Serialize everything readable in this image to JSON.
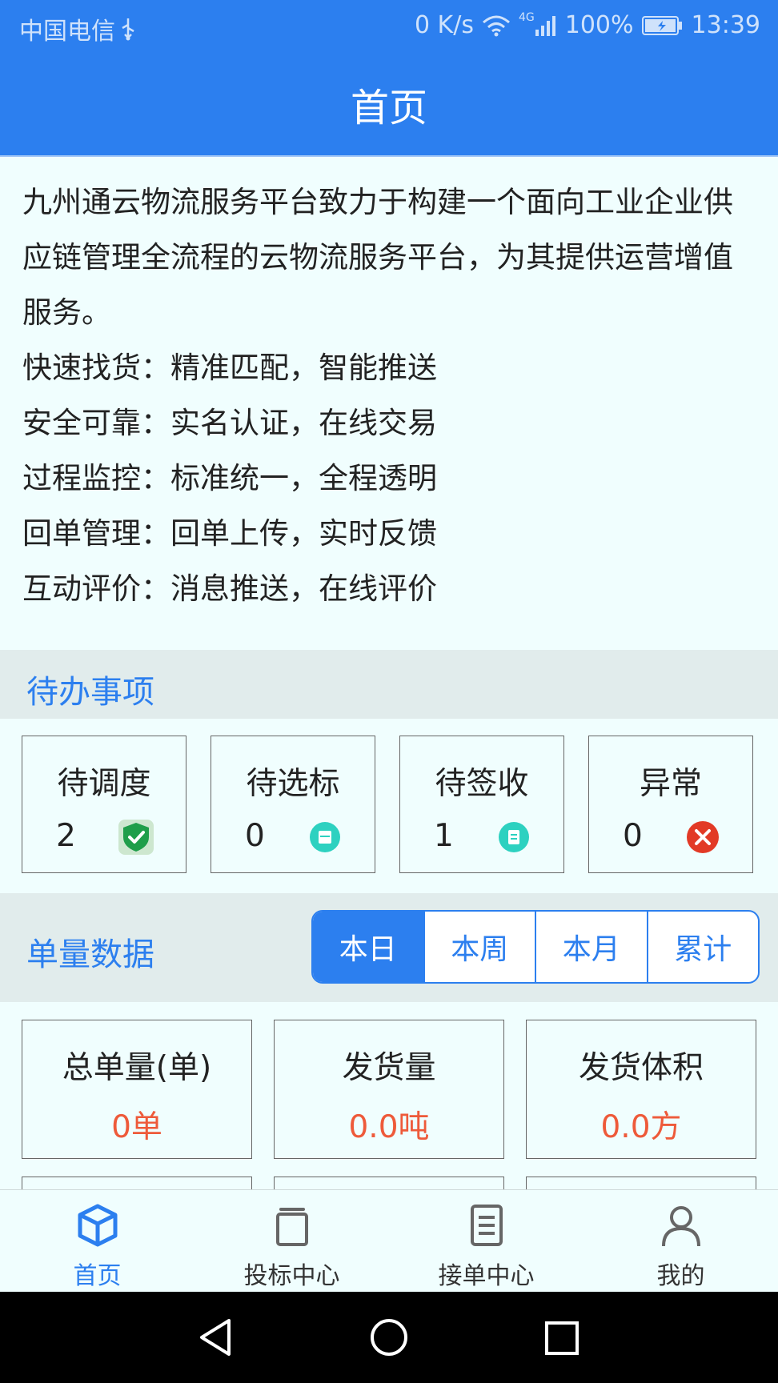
{
  "status_bar": {
    "carrier": "中国电信",
    "net_speed": "0 K/s",
    "network_type": "4G",
    "battery": "100%",
    "time": "13:39"
  },
  "header": {
    "title": "首页"
  },
  "intro": {
    "paragraph": "九州通云物流服务平台致力于构建一个面向工业企业供应链管理全流程的云物流服务平台，为其提供运营增值服务。",
    "features": [
      "快速找货：精准匹配，智能推送",
      "安全可靠：实名认证，在线交易",
      "过程监控：标准统一，全程透明",
      "回单管理：回单上传，实时反馈",
      "互动评价：消息推送，在线评价"
    ]
  },
  "todo": {
    "title": "待办事项",
    "items": [
      {
        "label": "待调度",
        "count": "2",
        "icon": "check-shield-icon",
        "color": "#1f9e4a"
      },
      {
        "label": "待选标",
        "count": "0",
        "icon": "box-icon",
        "color": "#2dd1c0"
      },
      {
        "label": "待签收",
        "count": "1",
        "icon": "document-icon",
        "color": "#2dd1c0"
      },
      {
        "label": "异常",
        "count": "0",
        "icon": "close-circle-icon",
        "color": "#e23a26"
      }
    ]
  },
  "volume": {
    "title": "单量数据",
    "periods": [
      "本日",
      "本周",
      "本月",
      "累计"
    ],
    "selected_period": "本日",
    "stats": [
      {
        "label": "总单量(单)",
        "value": "0单"
      },
      {
        "label": "发货量",
        "value": "0.0吨"
      },
      {
        "label": "发货体积",
        "value": "0.0方"
      }
    ]
  },
  "tabs": [
    {
      "label": "首页",
      "icon": "cube-icon",
      "active": true
    },
    {
      "label": "投标中心",
      "icon": "stack-icon",
      "active": false
    },
    {
      "label": "接单中心",
      "icon": "list-document-icon",
      "active": false
    },
    {
      "label": "我的",
      "icon": "person-icon",
      "active": false
    }
  ],
  "colors": {
    "primary": "#2c7fef",
    "background": "#f0fefe",
    "section_bar": "#e1ecec",
    "stat_value": "#ee5a3a"
  }
}
